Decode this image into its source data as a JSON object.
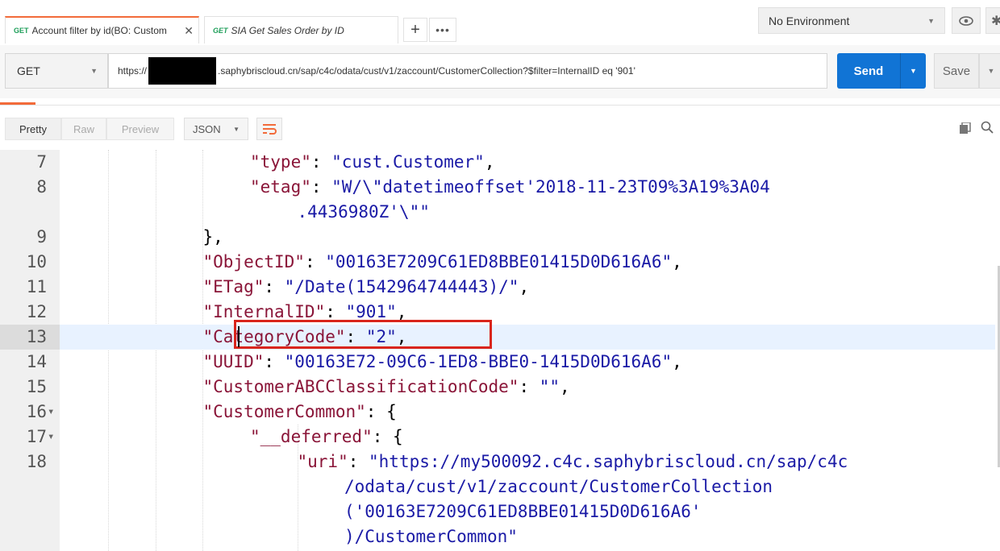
{
  "tabs": [
    {
      "method": "GET",
      "name": "Account filter by id(BO: Custom",
      "active": true
    },
    {
      "method": "GET",
      "name": "SIA Get Sales Order by ID",
      "active": false
    }
  ],
  "tab_actions": {
    "plus": "+",
    "more": "•••"
  },
  "environment": {
    "selected": "No Environment"
  },
  "request": {
    "method": "GET",
    "url_prefix": "https://",
    "url_rest": ".saphybriscloud.cn/sap/c4c/odata/cust/v1/zaccount/CustomerCollection?$filter=InternalID eq '901'",
    "send_label": "Send",
    "save_label": "Save"
  },
  "response_toolbar": {
    "views": [
      "Pretty",
      "Raw",
      "Preview"
    ],
    "active_view": "Pretty",
    "format": "JSON"
  },
  "editor": {
    "highlighted_line": 13,
    "lines": [
      {
        "num": "7",
        "fold": "",
        "indent": 4,
        "tokens": [
          [
            "k",
            "\"type\""
          ],
          [
            "p",
            ": "
          ],
          [
            "s",
            "\"cust.Customer\""
          ],
          [
            "p",
            ","
          ]
        ]
      },
      {
        "num": "8",
        "fold": "",
        "indent": 4,
        "tokens": [
          [
            "k",
            "\"etag\""
          ],
          [
            "p",
            ": "
          ],
          [
            "s",
            "\"W/\\\"datetimeoffset'2018-11-23T09%3A19%3A04"
          ]
        ]
      },
      {
        "num": "",
        "fold": "",
        "indent": 5,
        "tokens": [
          [
            "s",
            ".4436980Z'\\\"\""
          ]
        ]
      },
      {
        "num": "9",
        "fold": "",
        "indent": 3,
        "tokens": [
          [
            "p",
            "},"
          ]
        ]
      },
      {
        "num": "10",
        "fold": "",
        "indent": 3,
        "tokens": [
          [
            "k",
            "\"ObjectID\""
          ],
          [
            "p",
            ": "
          ],
          [
            "s",
            "\"00163E7209C61ED8BBE01415D0D616A6\""
          ],
          [
            "p",
            ","
          ]
        ]
      },
      {
        "num": "11",
        "fold": "",
        "indent": 3,
        "tokens": [
          [
            "k",
            "\"ETag\""
          ],
          [
            "p",
            ": "
          ],
          [
            "s",
            "\"/Date(1542964744443)/\""
          ],
          [
            "p",
            ","
          ]
        ]
      },
      {
        "num": "12",
        "fold": "",
        "indent": 3,
        "tokens": [
          [
            "k",
            "\"InternalID\""
          ],
          [
            "p",
            ": "
          ],
          [
            "s",
            "\"901\""
          ],
          [
            "p",
            ","
          ]
        ]
      },
      {
        "num": "13",
        "fold": "",
        "indent": 3,
        "tokens": [
          [
            "k",
            "\"CategoryCode\""
          ],
          [
            "p",
            ": "
          ],
          [
            "s",
            "\"2\""
          ],
          [
            "p",
            ","
          ]
        ]
      },
      {
        "num": "14",
        "fold": "",
        "indent": 3,
        "tokens": [
          [
            "k",
            "\"UUID\""
          ],
          [
            "p",
            ": "
          ],
          [
            "s",
            "\"00163E72-09C6-1ED8-BBE0-1415D0D616A6\""
          ],
          [
            "p",
            ","
          ]
        ]
      },
      {
        "num": "15",
        "fold": "",
        "indent": 3,
        "tokens": [
          [
            "k",
            "\"CustomerABCClassificationCode\""
          ],
          [
            "p",
            ": "
          ],
          [
            "s",
            "\"\""
          ],
          [
            "p",
            ","
          ]
        ]
      },
      {
        "num": "16",
        "fold": "▾",
        "indent": 3,
        "tokens": [
          [
            "k",
            "\"CustomerCommon\""
          ],
          [
            "p",
            ": {"
          ]
        ]
      },
      {
        "num": "17",
        "fold": "▾",
        "indent": 4,
        "tokens": [
          [
            "k",
            "\"__deferred\""
          ],
          [
            "p",
            ": {"
          ]
        ]
      },
      {
        "num": "18",
        "fold": "",
        "indent": 5,
        "tokens": [
          [
            "k",
            "\"uri\""
          ],
          [
            "p",
            ": "
          ],
          [
            "s",
            "\"https://my500092.c4c.saphybriscloud.cn/sap/c4c"
          ]
        ]
      },
      {
        "num": "",
        "fold": "",
        "indent": 6,
        "tokens": [
          [
            "s",
            "/odata/cust/v1/zaccount/CustomerCollection"
          ]
        ]
      },
      {
        "num": "",
        "fold": "",
        "indent": 6,
        "tokens": [
          [
            "s",
            "('00163E7209C61ED8BBE01415D0D616A6'"
          ]
        ]
      },
      {
        "num": "",
        "fold": "",
        "indent": 6,
        "tokens": [
          [
            "s",
            ")/CustomerCommon\""
          ]
        ]
      }
    ]
  }
}
